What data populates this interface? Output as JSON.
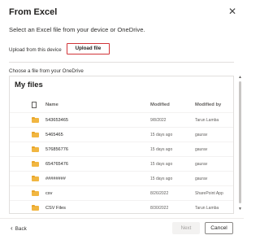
{
  "dialog": {
    "title": "From Excel",
    "close_icon": "close-icon",
    "subtitle": "Select an Excel file from your device or OneDrive.",
    "upload_label": "Upload from this device",
    "upload_button": "Upload file",
    "choose_label": "Choose a file from your OneDrive",
    "files_title": "My files"
  },
  "table": {
    "headers": {
      "icon": "file-icon",
      "name": "Name",
      "modified": "Modified",
      "modified_by": "Modified by"
    },
    "rows": [
      {
        "name": "543653465",
        "modified": "9/8/2022",
        "modified_by": "Tarun Lamba",
        "icon": "folder-icon"
      },
      {
        "name": "5465465",
        "modified": "15 days ago",
        "modified_by": "gaurav",
        "icon": "folder-icon"
      },
      {
        "name": "576856776",
        "modified": "15 days ago",
        "modified_by": "gaurav",
        "icon": "folder-icon"
      },
      {
        "name": "654765476",
        "modified": "15 days ago",
        "modified_by": "gaurav",
        "icon": "folder-icon"
      },
      {
        "name": "########",
        "modified": "15 days ago",
        "modified_by": "gaurav",
        "icon": "folder-icon"
      },
      {
        "name": "csv",
        "modified": "8/26/2022",
        "modified_by": "SharePoint App",
        "icon": "folder-icon"
      },
      {
        "name": "CSV Files",
        "modified": "8/30/2022",
        "modified_by": "Tarun Lamba",
        "icon": "folder-icon"
      }
    ]
  },
  "footer": {
    "back_label": "Back",
    "next_label": "Next",
    "cancel_label": "Cancel"
  },
  "colors": {
    "accent_border": "#d13438",
    "folder": "#f1b641"
  }
}
